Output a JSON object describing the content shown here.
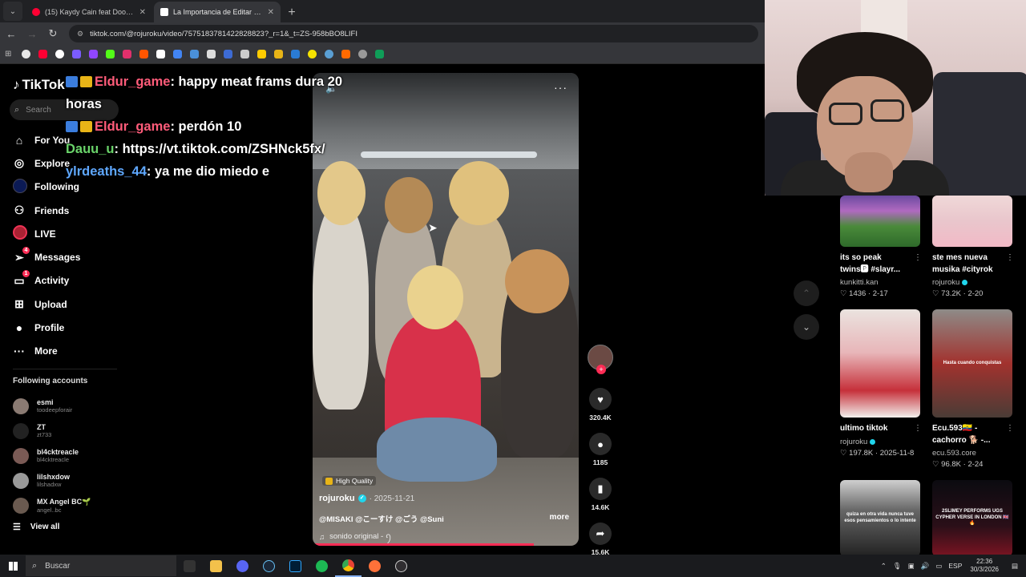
{
  "browser": {
    "tabs": [
      {
        "title": "(15) Kaydy Cain feat Doony Gra",
        "color": "#ff0033",
        "active": false
      },
      {
        "title": "La Importancia de Editar Fotos",
        "color": "#ffffff",
        "active": true
      }
    ],
    "url": "tiktok.com/@rojuroku/video/7575183781422828823?_r=1&_t=ZS-958bBO8LIFI"
  },
  "tiktok": {
    "logo": "TikTok",
    "search_placeholder": "Search",
    "nav": [
      {
        "label": "For You",
        "icon": "home-icon",
        "glyph": "⌂"
      },
      {
        "label": "Explore",
        "icon": "compass-icon",
        "glyph": "◎"
      },
      {
        "label": "Following",
        "icon": "following-avatar",
        "glyph": ""
      },
      {
        "label": "Friends",
        "icon": "friends-icon",
        "glyph": "⚇"
      },
      {
        "label": "LIVE",
        "icon": "live-avatar",
        "glyph": ""
      },
      {
        "label": "Messages",
        "icon": "messages-icon",
        "glyph": "➢",
        "badge": "4"
      },
      {
        "label": "Activity",
        "icon": "activity-icon",
        "glyph": "▭",
        "badge": "1"
      },
      {
        "label": "Upload",
        "icon": "upload-icon",
        "glyph": "⊞"
      },
      {
        "label": "Profile",
        "icon": "profile-icon",
        "glyph": "●"
      },
      {
        "label": "More",
        "icon": "more-icon",
        "glyph": "···"
      }
    ],
    "following_title": "Following accounts",
    "accounts": [
      {
        "name": "esmi",
        "handle": "toodeepforair",
        "color": "#8a7a72"
      },
      {
        "name": "ZT",
        "handle": "zt733",
        "color": "#222222"
      },
      {
        "name": "bl4cktreacle",
        "handle": "bl4cktreacle",
        "color": "#7a5a55"
      },
      {
        "name": "lilshxdow",
        "handle": "lilshadxw",
        "color": "#999999"
      },
      {
        "name": "MX Angel BC🌱",
        "handle": "angel..bc",
        "color": "#6a5a50"
      }
    ],
    "view_all": "View all"
  },
  "chat": [
    {
      "user": "Eldur_game",
      "msg": ": happy meat frams dura 20 horas",
      "badges": true,
      "cls": "u1"
    },
    {
      "user": "Eldur_game",
      "msg": ": perdón 10",
      "badges": true,
      "cls": "u1"
    },
    {
      "user": "Dauu_u",
      "msg": ": https://vt.tiktok.com/ZSHNck5fx/",
      "badges": false,
      "cls": "u2"
    },
    {
      "user": "ylrdeaths_44",
      "msg": ": ya me dio miedo e",
      "badges": false,
      "cls": "u3"
    }
  ],
  "video": {
    "quality": "High Quality",
    "author": "rojuroku",
    "date": "· 2025-11-21",
    "description": "@MISAKI @こーすけ @ごう @Suni",
    "more": "more",
    "sound": "sonido original - ꪆ",
    "progress_fraction": 0.83
  },
  "actions": {
    "likes": "320.4K",
    "comments": "1185",
    "saves": "14.6K",
    "shares": "15.6K"
  },
  "recommendations": [
    {
      "title": "its so peak twins🅿 #slayr...",
      "author": "kunkitti.kan",
      "verified": false,
      "likes": "1436",
      "date": "2-17",
      "thumb": "green"
    },
    {
      "title": "ste mes nueva musika #cityrok",
      "author": "rojuroku",
      "verified": true,
      "likes": "73.2K",
      "date": "2-20",
      "thumb": "pink"
    },
    {
      "title": "ultimo tiktok",
      "author": "rojuroku",
      "verified": true,
      "likes": "197.8K",
      "date": "2025-11-8",
      "thumb": "cream"
    },
    {
      "title": "Ecu.593🇪🇨 - cachorro 🐕 -...",
      "author": "ecu.593.core",
      "verified": false,
      "likes": "96.8K",
      "date": "2-24",
      "thumb": "red",
      "overlay": "Hasta cuando conquistas"
    },
    {
      "title": "",
      "author": "",
      "verified": false,
      "likes": "",
      "date": "",
      "thumb": "manga",
      "overlay": "quiza en otra vida nunca tuve esos pensamientos o lo intente"
    },
    {
      "title": "",
      "author": "",
      "verified": false,
      "likes": "",
      "date": "",
      "thumb": "dark",
      "overlay": "2SLIMEY PERFORMS UGS CYPHER VERSE IN LONDON 🇬🇧🔥"
    }
  ],
  "taskbar": {
    "search": "Buscar",
    "lang": "ESP",
    "time": "22:36",
    "date": "30/3/2026"
  }
}
